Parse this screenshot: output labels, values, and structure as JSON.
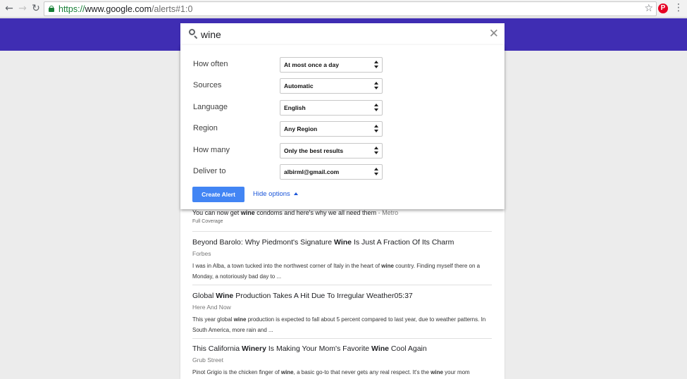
{
  "browser": {
    "url_scheme": "https://",
    "url_host": "www.google.com",
    "url_path": "/alerts#1:0",
    "back_icon": "arrow-back-icon",
    "forward_icon": "arrow-forward-icon",
    "reload_icon": "reload-icon",
    "secure_icon": "lock-icon",
    "bookmark_icon": "star-icon",
    "extension_icon": "pinterest-icon",
    "menu_icon": "vertical-dots-icon"
  },
  "colors": {
    "header": "#3f2db3",
    "button": "#4285f4",
    "link": "#1a55d9"
  },
  "search": {
    "term": "wine",
    "icon": "search-icon",
    "clear_icon": "close-icon"
  },
  "options": [
    {
      "label": "How often",
      "value": "At most once a day"
    },
    {
      "label": "Sources",
      "value": "Automatic"
    },
    {
      "label": "Language",
      "value": "English"
    },
    {
      "label": "Region",
      "value": "Any Region"
    },
    {
      "label": "How many",
      "value": "Only the best results"
    },
    {
      "label": "Deliver to",
      "value": "albirml@gmail.com"
    }
  ],
  "actions": {
    "create_label": "Create Alert",
    "hide_label": "Hide options"
  },
  "preview": {
    "top_snippet": {
      "pre": "You can now get ",
      "bold": "wine",
      "post": " condoms and here's why we all need them",
      "source": " - Metro"
    },
    "full_coverage": "Full Coverage",
    "articles": [
      {
        "title": [
          {
            "t": "Beyond Barolo: Why Piedmont's Signature "
          },
          {
            "t": "Wine",
            "b": true
          },
          {
            "t": " Is Just A Fraction Of Its Charm"
          }
        ],
        "source": "Forbes",
        "snippet": [
          {
            "t": "I was in Alba, a town tucked into the northwest corner of Italy in the heart of "
          },
          {
            "t": "wine",
            "b": true
          },
          {
            "t": " country. Finding myself there on a Monday, a notoriously bad day to ..."
          }
        ]
      },
      {
        "title": [
          {
            "t": "Global "
          },
          {
            "t": "Wine",
            "b": true
          },
          {
            "t": " Production Takes A Hit Due To Irregular Weather05:37"
          }
        ],
        "source": "Here And Now",
        "snippet": [
          {
            "t": "This year global "
          },
          {
            "t": "wine",
            "b": true
          },
          {
            "t": " production is expected to fall about 5 percent compared to last year, due to weather patterns. In South America, more rain and ..."
          }
        ]
      },
      {
        "title": [
          {
            "t": "This California "
          },
          {
            "t": "Winery",
            "b": true
          },
          {
            "t": " Is Making Your Mom's Favorite "
          },
          {
            "t": "Wine",
            "b": true
          },
          {
            "t": " Cool Again"
          }
        ],
        "source": "Grub Street",
        "snippet": [
          {
            "t": "Pinot Grigio is the chicken finger of "
          },
          {
            "t": "wine",
            "b": true
          },
          {
            "t": ", a basic go-to that never gets any real respect. It's the "
          },
          {
            "t": "wine",
            "b": true
          },
          {
            "t": " your mom"
          }
        ]
      }
    ]
  }
}
